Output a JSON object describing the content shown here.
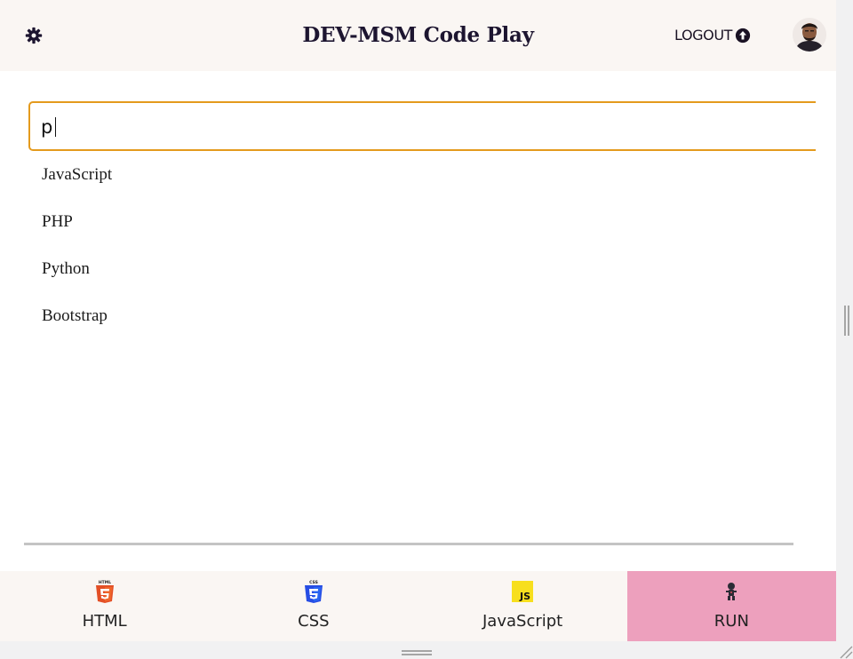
{
  "header": {
    "title": "DEV-MSM Code Play",
    "logout_label": "LOGOUT",
    "icons": [
      "gear-icon",
      "upload-circle-icon",
      "user-avatar"
    ]
  },
  "search": {
    "value": "p"
  },
  "suggestions": [
    "JavaScript",
    "PHP",
    "Python",
    "Bootstrap"
  ],
  "tabs": [
    {
      "label": "HTML",
      "icon": "html5-icon"
    },
    {
      "label": "CSS",
      "icon": "css3-icon"
    },
    {
      "label": "JavaScript",
      "icon": "js-icon"
    },
    {
      "label": "RUN",
      "icon": "runner-icon"
    }
  ],
  "colors": {
    "header_bg": "#faf6f3",
    "input_border": "#e49a1d",
    "run_bg": "#eda0bd",
    "title_text": "#1d1530"
  }
}
